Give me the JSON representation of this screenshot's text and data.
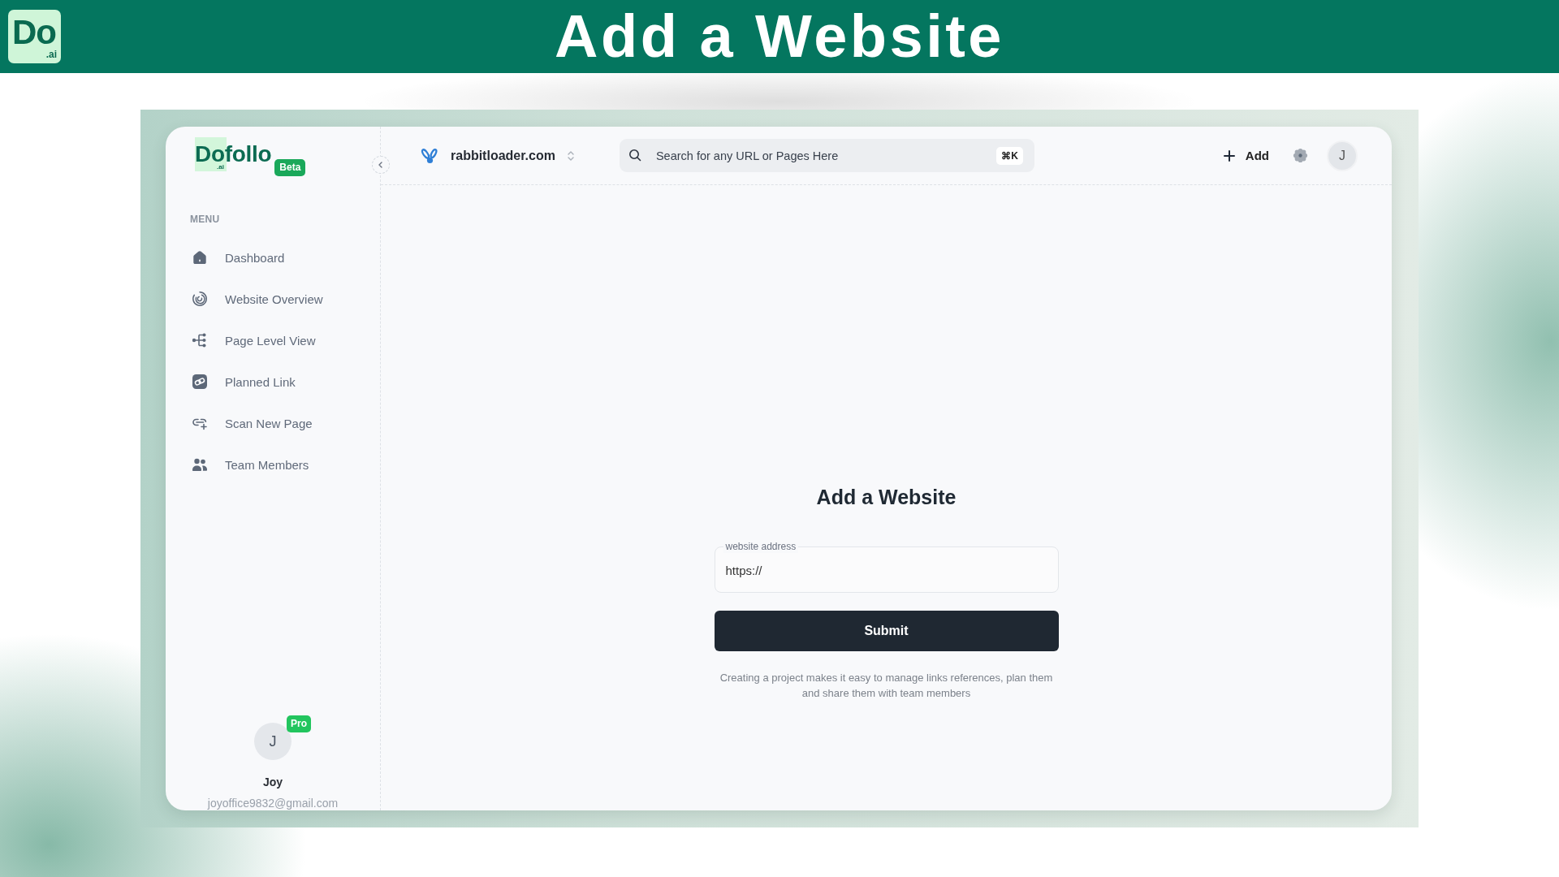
{
  "banner": {
    "logo": {
      "mark": "Do",
      "suffix": ".ai"
    },
    "title": "Add a Website"
  },
  "sidebar": {
    "logo": {
      "wordmark": "Dofollo",
      "suffix": ".ai",
      "badge": "Beta"
    },
    "menu_label": "MENU",
    "items": [
      {
        "label": "Dashboard",
        "selected": false
      },
      {
        "label": "Website Overview",
        "selected": false
      },
      {
        "label": "Page Level View",
        "selected": false
      },
      {
        "label": "Planned Link",
        "selected": false
      },
      {
        "label": "Scan New Page",
        "selected": false
      },
      {
        "label": "Team Members",
        "selected": false
      }
    ],
    "user": {
      "avatar": "J",
      "badge": "Pro",
      "name": "Joy",
      "email": "joyoffice9832@gmail.com"
    }
  },
  "header": {
    "site": "rabbitloader.com",
    "search": {
      "placeholder": "Search for any URL or Pages Here",
      "shortcut": "⌘K"
    },
    "add_button": "Add",
    "avatar": "J"
  },
  "form": {
    "title": "Add a Website",
    "field": {
      "label": "website address",
      "value": "https://"
    },
    "submit": "Submit",
    "note": "Creating a project makes it easy to manage links references, plan them and share them with team members"
  }
}
